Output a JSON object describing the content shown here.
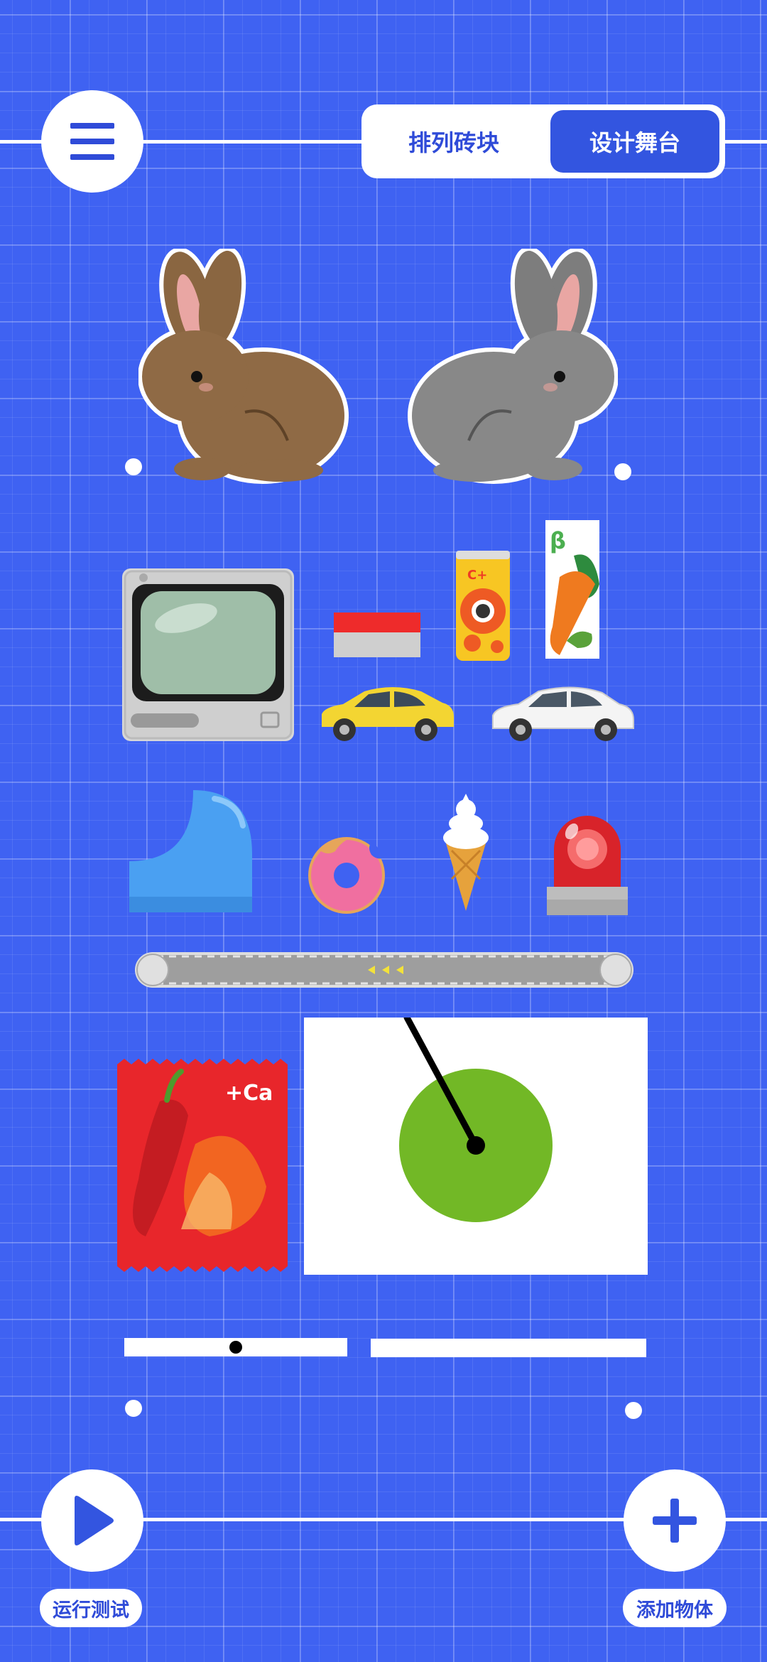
{
  "mode_tabs": {
    "arrange": "排列砖块",
    "design": "设计舞台",
    "active": "design"
  },
  "buttons": {
    "run_label": "运行测试",
    "add_label": "添加物体"
  },
  "stage": {
    "items": [
      "brown-rabbit-icon",
      "gray-rabbit-icon",
      "retro-tv-icon",
      "red-gray-block-icon",
      "energy-drink-can-icon",
      "carrot-juice-box-icon",
      "yellow-car-icon",
      "white-car-icon",
      "blue-ramp-icon",
      "donut-icon",
      "ice-cream-cone-icon",
      "red-siren-icon",
      "conveyor-belt-icon",
      "chili-snack-bag-icon",
      "pendulum-panel",
      "white-bar-left",
      "white-bar-right"
    ],
    "snack_bag_text": "+Ca",
    "can_text": "C+",
    "juice_text": "β",
    "colors": {
      "background": "#3f62f2",
      "accent": "#3355e0",
      "pendulum_ball": "#72b826"
    }
  }
}
